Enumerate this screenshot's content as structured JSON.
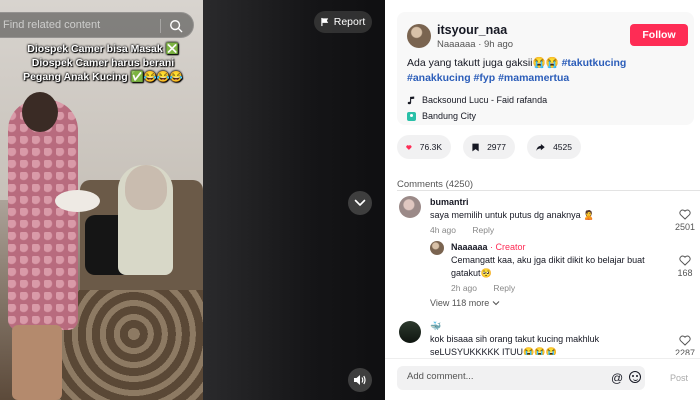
{
  "video": {
    "search_placeholder": "Find related content",
    "overlay_lines": [
      "Diospek Camer bisa Masak ❎",
      "Diospek Camer harus berani",
      "Pegang Anak Kucing ✅😂😂😂"
    ],
    "report_label": "Report"
  },
  "post": {
    "username": "itsyour_naa",
    "display_name": "Naaaaaa",
    "time_ago": "9h ago",
    "follow_label": "Follow",
    "caption_text": "Ada yang takutt juga gaksii😭😭 ",
    "hashtags": [
      "#takutkucing",
      "#anakkucing",
      "#fyp",
      "#mamamertua"
    ],
    "music": "Backsound Lucu - Faid rafanda",
    "location": "Bandung City",
    "likes": "76.3K",
    "saves": "2977",
    "shares": "4525",
    "accent_color": "#fe2c55"
  },
  "comments": {
    "header": "Comments (4250)",
    "items": [
      {
        "name": "bumantri",
        "text": "saya memilih untuk putus dg anaknya 🙎",
        "time": "4h ago",
        "reply_label": "Reply",
        "likes": "2501"
      },
      {
        "name": "Naaaaaa",
        "badge": " · Creator",
        "text": "Cemangatt kaa, aku jga dikit dikit ko belajar buat gatakut🥺",
        "time": "2h ago",
        "reply_label": "Reply",
        "likes": "168"
      },
      {
        "view_more": "View 118 more"
      },
      {
        "name": "🐳",
        "text": "kok bisaaa sih orang takut kucing makhluk seLUSYUKKKKK ITUU😭😭😭",
        "likes": "2287"
      }
    ],
    "input_placeholder": "Add comment...",
    "post_label": "Post"
  }
}
